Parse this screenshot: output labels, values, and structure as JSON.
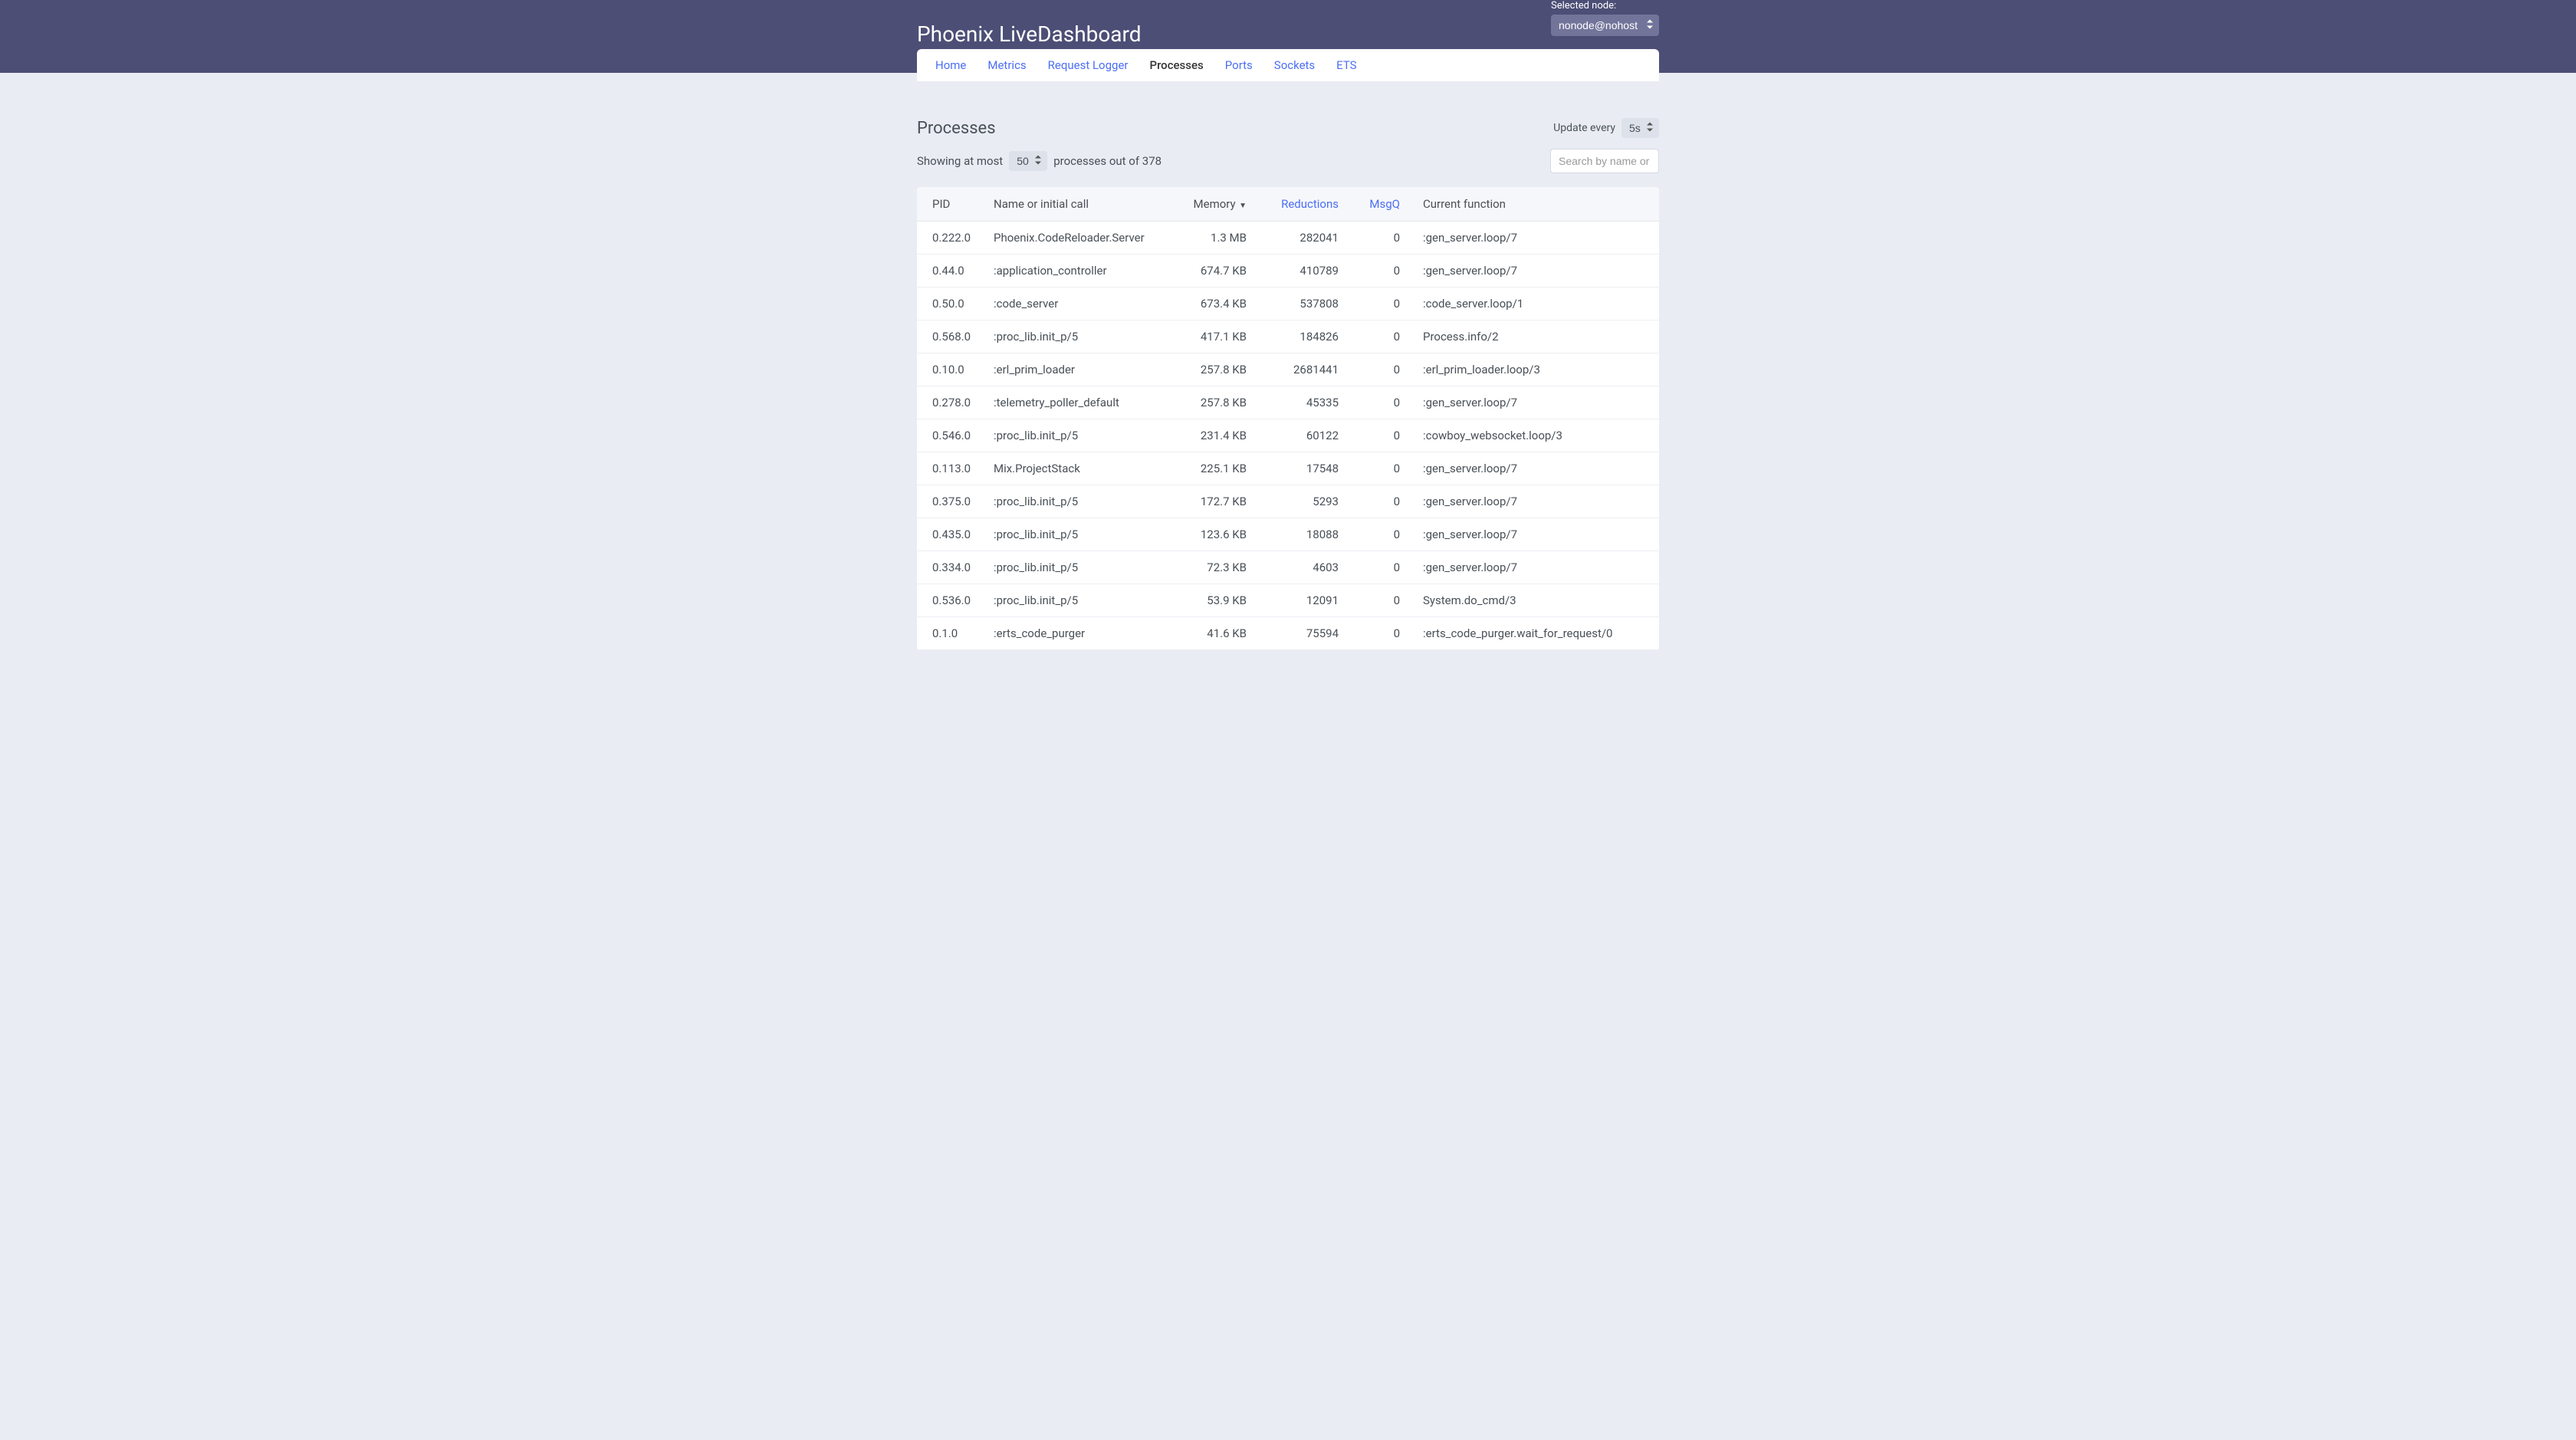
{
  "header": {
    "title": "Phoenix LiveDashboard",
    "node_label": "Selected node:",
    "node_value": "nonode@nohost"
  },
  "nav": {
    "tabs": [
      {
        "label": "Home",
        "active": false
      },
      {
        "label": "Metrics",
        "active": false
      },
      {
        "label": "Request Logger",
        "active": false
      },
      {
        "label": "Processes",
        "active": true
      },
      {
        "label": "Ports",
        "active": false
      },
      {
        "label": "Sockets",
        "active": false
      },
      {
        "label": "ETS",
        "active": false
      }
    ]
  },
  "page": {
    "title": "Processes",
    "update_label": "Update every",
    "update_value": "5s",
    "showing_prefix": "Showing at most",
    "limit_value": "50",
    "showing_suffix": "processes out of 378",
    "search_placeholder": "Search by name or PID"
  },
  "table": {
    "headers": {
      "pid": "PID",
      "name": "Name or initial call",
      "memory": "Memory",
      "reductions": "Reductions",
      "msgq": "MsgQ",
      "func": "Current function"
    },
    "rows": [
      {
        "pid": "0.222.0",
        "name": "Phoenix.CodeReloader.Server",
        "memory": "1.3 MB",
        "reductions": "282041",
        "msgq": "0",
        "func": ":gen_server.loop/7"
      },
      {
        "pid": "0.44.0",
        "name": ":application_controller",
        "memory": "674.7 KB",
        "reductions": "410789",
        "msgq": "0",
        "func": ":gen_server.loop/7"
      },
      {
        "pid": "0.50.0",
        "name": ":code_server",
        "memory": "673.4 KB",
        "reductions": "537808",
        "msgq": "0",
        "func": ":code_server.loop/1"
      },
      {
        "pid": "0.568.0",
        "name": ":proc_lib.init_p/5",
        "memory": "417.1 KB",
        "reductions": "184826",
        "msgq": "0",
        "func": "Process.info/2"
      },
      {
        "pid": "0.10.0",
        "name": ":erl_prim_loader",
        "memory": "257.8 KB",
        "reductions": "2681441",
        "msgq": "0",
        "func": ":erl_prim_loader.loop/3"
      },
      {
        "pid": "0.278.0",
        "name": ":telemetry_poller_default",
        "memory": "257.8 KB",
        "reductions": "45335",
        "msgq": "0",
        "func": ":gen_server.loop/7"
      },
      {
        "pid": "0.546.0",
        "name": ":proc_lib.init_p/5",
        "memory": "231.4 KB",
        "reductions": "60122",
        "msgq": "0",
        "func": ":cowboy_websocket.loop/3"
      },
      {
        "pid": "0.113.0",
        "name": "Mix.ProjectStack",
        "memory": "225.1 KB",
        "reductions": "17548",
        "msgq": "0",
        "func": ":gen_server.loop/7"
      },
      {
        "pid": "0.375.0",
        "name": ":proc_lib.init_p/5",
        "memory": "172.7 KB",
        "reductions": "5293",
        "msgq": "0",
        "func": ":gen_server.loop/7"
      },
      {
        "pid": "0.435.0",
        "name": ":proc_lib.init_p/5",
        "memory": "123.6 KB",
        "reductions": "18088",
        "msgq": "0",
        "func": ":gen_server.loop/7"
      },
      {
        "pid": "0.334.0",
        "name": ":proc_lib.init_p/5",
        "memory": "72.3 KB",
        "reductions": "4603",
        "msgq": "0",
        "func": ":gen_server.loop/7"
      },
      {
        "pid": "0.536.0",
        "name": ":proc_lib.init_p/5",
        "memory": "53.9 KB",
        "reductions": "12091",
        "msgq": "0",
        "func": "System.do_cmd/3"
      },
      {
        "pid": "0.1.0",
        "name": ":erts_code_purger",
        "memory": "41.6 KB",
        "reductions": "75594",
        "msgq": "0",
        "func": ":erts_code_purger.wait_for_request/0"
      }
    ]
  }
}
